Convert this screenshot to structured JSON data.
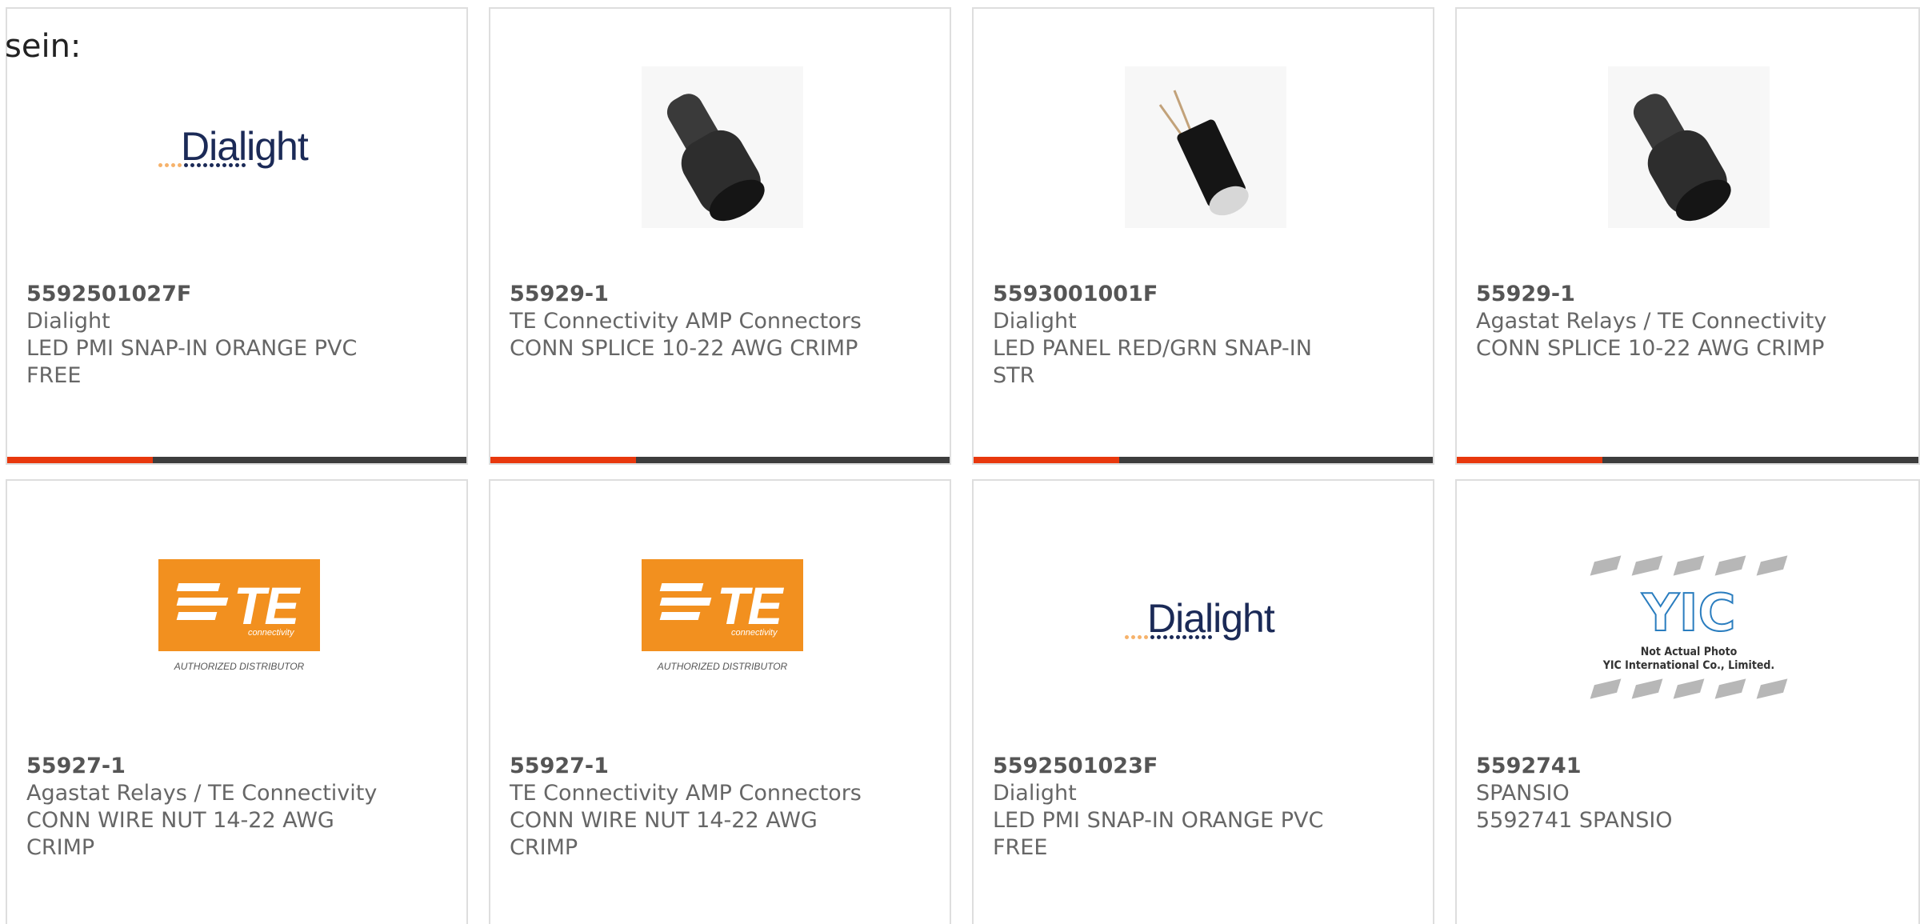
{
  "page": {
    "heading_fragment": "sein:"
  },
  "colors": {
    "accent": "#e8380d",
    "bar_dark": "#3d3d3d",
    "card_border": "#dedede",
    "dialight_navy": "#1b2a57",
    "te_orange": "#f2901f",
    "yic_blue": "#2a7dbf"
  },
  "products": [
    {
      "part": "5592501027F",
      "maker": "Dialight",
      "desc_line1": "LED PMI SNAP-IN ORANGE PVC",
      "desc_line2": "FREE",
      "image": "dialight-logo"
    },
    {
      "part": "55929-1",
      "maker": "TE Connectivity AMP Connectors",
      "desc_line1": "CONN SPLICE 10-22 AWG CRIMP",
      "desc_line2": "",
      "image": "black-splice-cap"
    },
    {
      "part": "5593001001F",
      "maker": "Dialight",
      "desc_line1": "LED PANEL RED/GRN SNAP-IN",
      "desc_line2": "STR",
      "image": "led-panel-indicator"
    },
    {
      "part": "55929-1",
      "maker": "Agastat Relays / TE Connectivity",
      "desc_line1": "CONN SPLICE 10-22 AWG CRIMP",
      "desc_line2": "",
      "image": "black-splice-cap"
    },
    {
      "part": "55927-1",
      "maker": "Agastat Relays / TE Connectivity",
      "desc_line1": "CONN WIRE NUT 14-22 AWG",
      "desc_line2": "CRIMP",
      "image": "te-logo"
    },
    {
      "part": "55927-1",
      "maker": "TE Connectivity AMP Connectors",
      "desc_line1": "CONN WIRE NUT 14-22 AWG",
      "desc_line2": "CRIMP",
      "image": "te-logo"
    },
    {
      "part": "5592501023F",
      "maker": "Dialight",
      "desc_line1": "LED PMI SNAP-IN ORANGE PVC",
      "desc_line2": "FREE",
      "image": "dialight-logo"
    },
    {
      "part": "5592741",
      "maker": "SPANSIO",
      "desc_line1": "5592741 SPANSIO",
      "desc_line2": "",
      "image": "yic-placeholder"
    }
  ],
  "logos": {
    "dialight_word": "Dialight",
    "te_word": "TE",
    "te_connectivity": "connectivity",
    "te_authorized": "AUTHORIZED DISTRIBUTOR",
    "yic_mark": "YIC",
    "yic_note_line1": "Not Actual Photo",
    "yic_note_line2": "YIC International Co., Limited."
  }
}
